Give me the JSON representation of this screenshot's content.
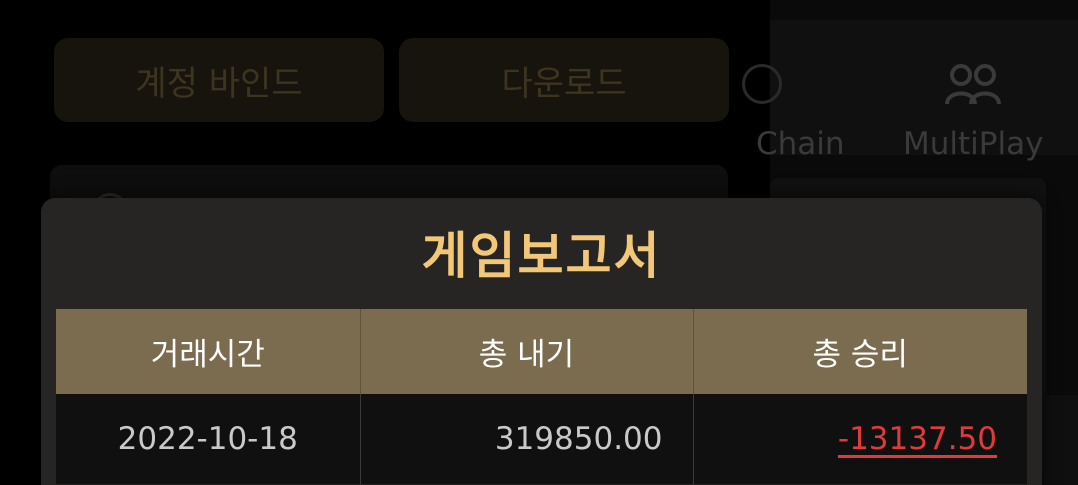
{
  "background": {
    "bind_account_label": "계정 바인드",
    "download_label": "다운로드",
    "tabs": [
      {
        "label": "Chain",
        "icon": "chain-icon"
      },
      {
        "label": "MultiPlay",
        "icon": "users-icon"
      }
    ]
  },
  "report": {
    "title": "게임보고서",
    "columns": [
      "거래시간",
      "총 내기",
      "총 승리"
    ],
    "rows": [
      {
        "time": "2022-10-18",
        "total_bet": "319850.00",
        "total_win": "-13137.50"
      }
    ]
  },
  "colors": {
    "title": "#f2c878",
    "header_bg": "#7b6b4f",
    "negative": "#e03a3a",
    "modal_bg": "#272524"
  }
}
